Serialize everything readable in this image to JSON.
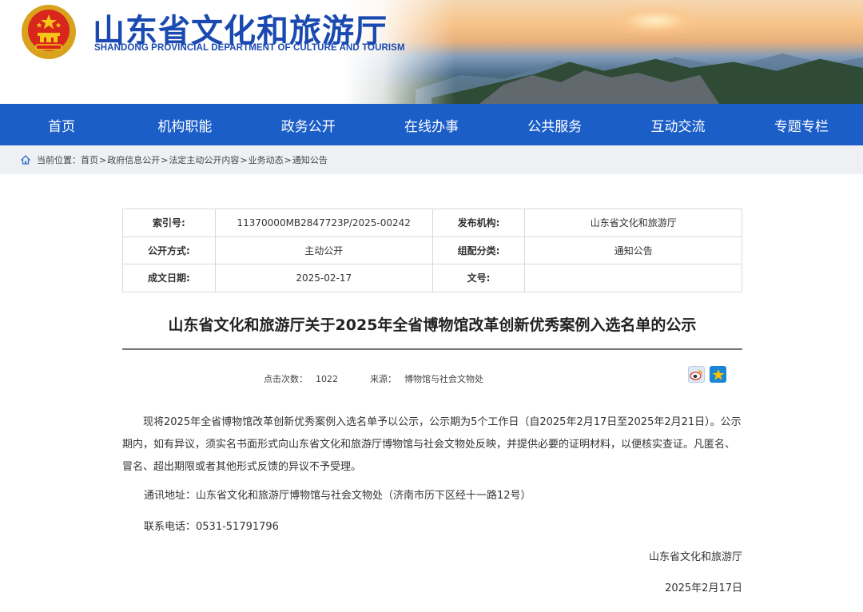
{
  "header": {
    "site_title": "山东省文化和旅游厅",
    "site_subtitle": "SHANDONG PROVINCIAL DEPARTMENT OF CULTURE AND TOURISM",
    "brand_blue": "#1a4ab1"
  },
  "nav": {
    "color": "#1c5ec8",
    "items": [
      "首页",
      "机构职能",
      "政务公开",
      "在线办事",
      "公共服务",
      "互动交流",
      "专题专栏"
    ]
  },
  "breadcrumb": {
    "icon": "home-icon",
    "label": "当前位置：",
    "items": [
      "首页",
      "政府信息公开",
      "法定主动公开内容",
      "业务动态",
      "通知公告"
    ],
    "separator": ">"
  },
  "meta": {
    "rows": [
      {
        "l1": "索引号:",
        "v1": "11370000MB2847723P/2025-00242",
        "l2": "发布机构:",
        "v2": "山东省文化和旅游厅"
      },
      {
        "l1": "公开方式:",
        "v1": "主动公开",
        "l2": "组配分类:",
        "v2": "通知公告"
      },
      {
        "l1": "成文日期:",
        "v1": "2025-02-17",
        "l2": "文号:",
        "v2": ""
      }
    ]
  },
  "article": {
    "title": "山东省文化和旅游厅关于2025年全省博物馆改革创新优秀案例入选名单的公示",
    "hits_label": "点击次数：",
    "hits_value": "1022",
    "source_label": "来源：",
    "source_value": "博物馆与社会文物处",
    "share_icons": [
      "weibo-icon",
      "favorite-star-icon"
    ],
    "paragraph1": "现将2025年全省博物馆改革创新优秀案例入选名单予以公示，公示期为5个工作日（自2025年2月17日至2025年2月21日）。公示期内，如有异议，须实名书面形式向山东省文化和旅游厅博物馆与社会文物处反映，并提供必要的证明材料，以便核实查证。凡匿名、冒名、超出期限或者其他形式反馈的异议不予受理。",
    "address": "通讯地址：山东省文化和旅游厅博物馆与社会文物处（济南市历下区经十一路12号）",
    "phone": "联系电话：0531-51791796",
    "signature_org": "山东省文化和旅游厅",
    "signature_date": "2025年2月17日"
  }
}
